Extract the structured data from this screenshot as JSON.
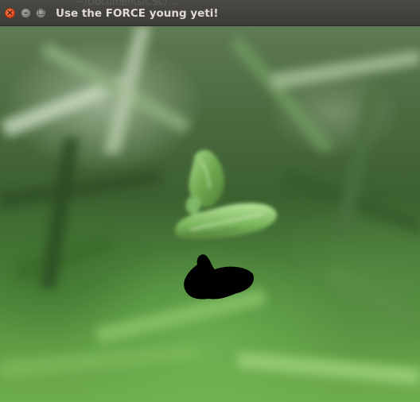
{
  "window": {
    "title": "Use the FORCE young yeti!",
    "background_path_hint": "~/Documents/CSC/..."
  },
  "titlebar": {
    "close_glyph": "×",
    "minimize_glyph": "–",
    "maximize_glyph": "□"
  },
  "colors": {
    "titlebar": "#3c3b37",
    "close_button": "#e0491a",
    "title_text": "#dfdbd2",
    "grass_dark": "#3c6030",
    "grass_light": "#6fae4d",
    "yeti_green": "#7bbf5a",
    "shadow": "#000000"
  },
  "scene": {
    "background": "blurred-grass-texture",
    "model": "green-yeti-model",
    "shadow": "black-shadow-blob"
  }
}
